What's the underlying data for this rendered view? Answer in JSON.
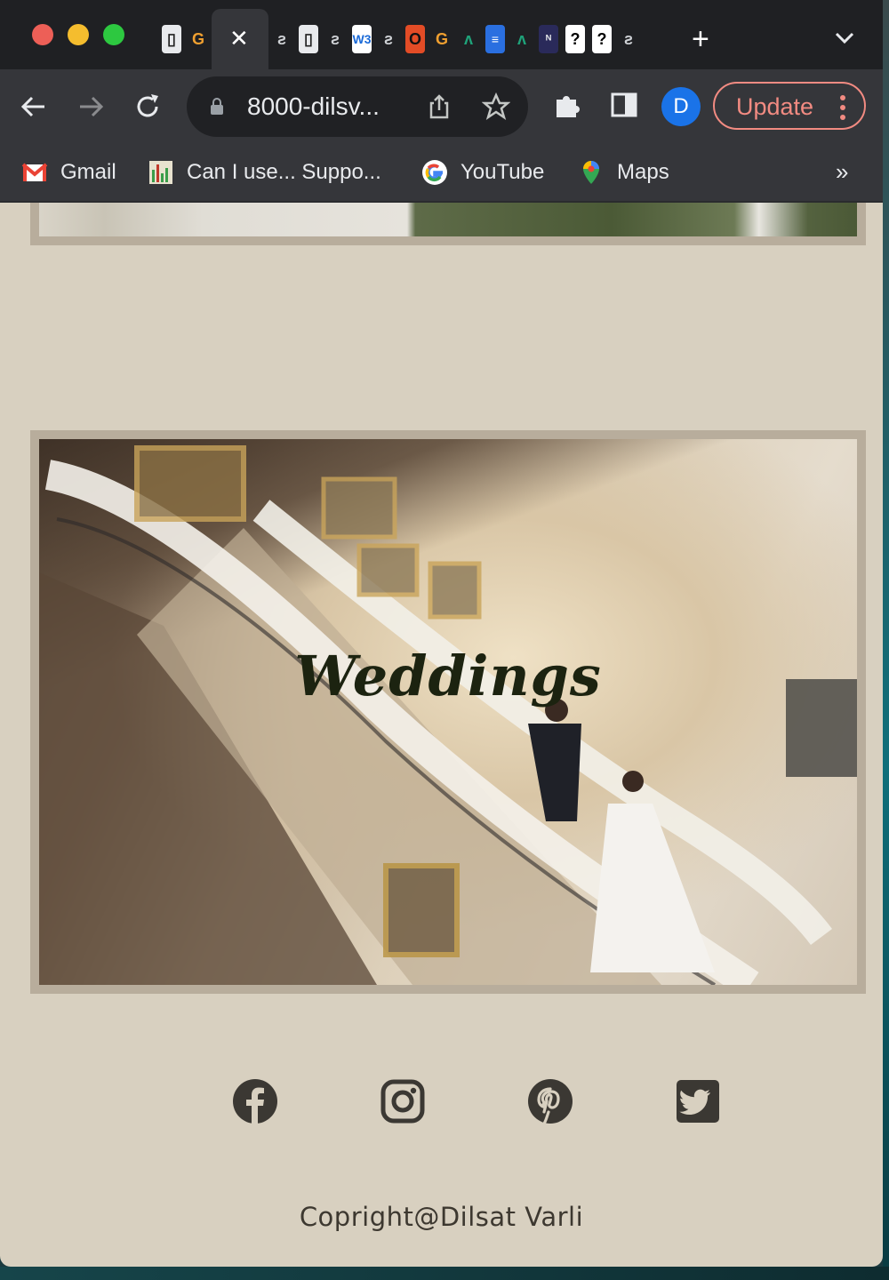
{
  "browser": {
    "active_tab_close": "✕",
    "new_tab": "+",
    "url": "8000-dilsv...",
    "profile_initial": "D",
    "update_label": "Update",
    "more_bookmarks": "»",
    "bookmarks": [
      {
        "label": "Gmail",
        "icon": "gmail-icon"
      },
      {
        "label": "Can I use... Suppo...",
        "icon": "caniuse-icon"
      },
      {
        "label": "YouTube",
        "icon": "google-icon"
      },
      {
        "label": "Maps",
        "icon": "maps-pin-icon"
      }
    ]
  },
  "page": {
    "section_title": "Weddings",
    "social_icons": [
      "facebook-icon",
      "instagram-icon",
      "pinterest-icon",
      "twitter-icon"
    ],
    "copyright": "Copright@Dilsat Varli"
  },
  "colors": {
    "page_bg": "#d8d0c0",
    "frame": "#b8ad9c",
    "icon": "#3b3833",
    "update_accent": "#f28b82",
    "profile": "#1a73e8"
  }
}
